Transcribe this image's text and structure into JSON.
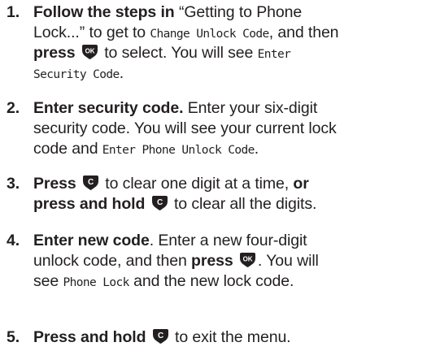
{
  "steps": [
    {
      "number": "1.",
      "line1_bold": "Follow the steps in",
      "line1_text": " “Getting to Phone",
      "line2_text": "Lock...” to get to ",
      "line2_lcd": "Change Unlock Code",
      "line2_after": ", and then",
      "line3_bold": "press",
      "line3_text": " to select. You will see ",
      "line3_lcd": "Enter",
      "line4_lcd": "Security Code",
      "line4_after": "."
    },
    {
      "number": "2.",
      "line1_bold": "Enter security code.",
      "line1_text": " Enter your six-digit",
      "line2_text": "security code. You will see your current lock",
      "line3_text": "code and ",
      "line3_lcd": "Enter Phone Unlock Code",
      "line3_after": "."
    },
    {
      "number": "3.",
      "line1_bold": "Press",
      "line1_text": " to clear one digit at a time, ",
      "line1_bold2": "or",
      "line2_bold": "press and hold",
      "line2_text": " to clear all the digits."
    },
    {
      "number": "4.",
      "line1_bold": "Enter new code",
      "line1_text": ". Enter a new four-digit",
      "line2_text": "unlock code, and then ",
      "line2_bold": "press",
      "line2_after": ". You will",
      "line3_text": "see ",
      "line3_lcd": "Phone Lock",
      "line3_after": " and the new lock code."
    },
    {
      "number": "5.",
      "line1_bold": "Press and hold",
      "line1_text": " to exit the menu."
    }
  ],
  "icons": {
    "ok_key": "ok-key-icon",
    "clear_key": "clear-key-icon",
    "ok_key_label": "OK",
    "clear_key_label": "C"
  },
  "colors": {
    "text": "#231f20",
    "key_fill": "#231f20",
    "key_label": "#ffffff"
  }
}
